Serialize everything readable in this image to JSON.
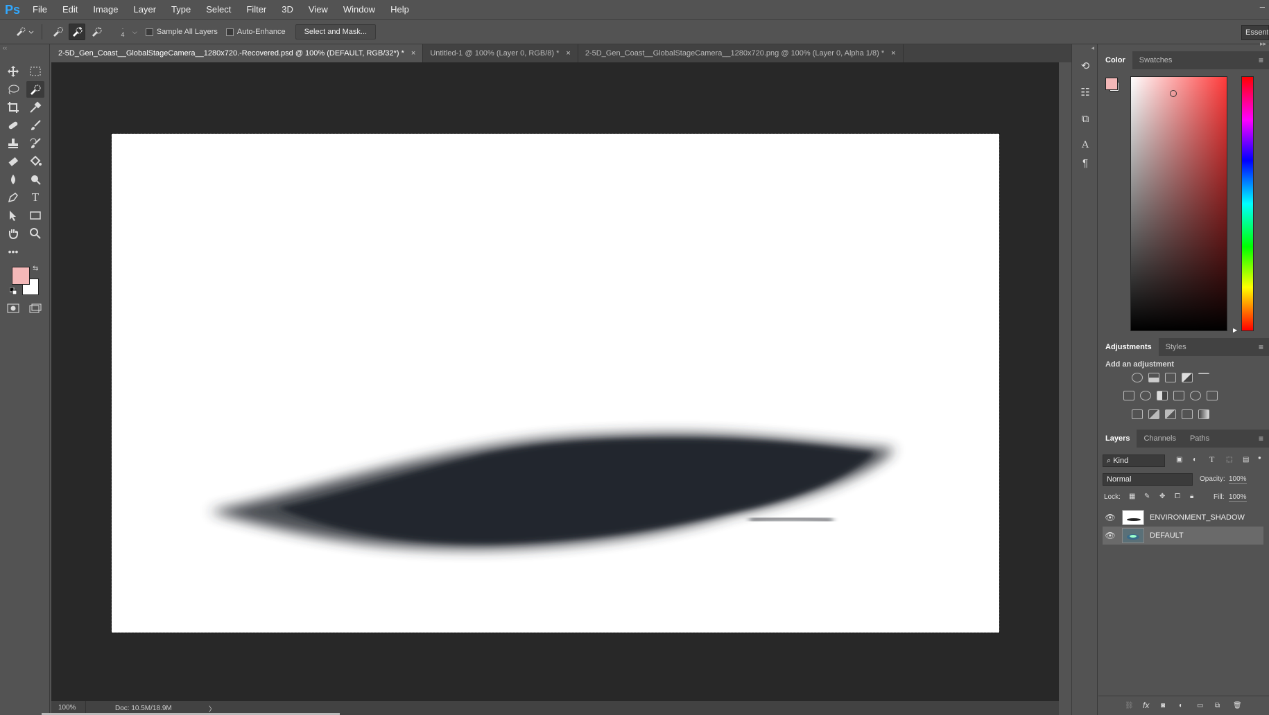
{
  "app": {
    "logo": "Ps",
    "window_controls": "–"
  },
  "menu": [
    "File",
    "Edit",
    "Image",
    "Layer",
    "Type",
    "Select",
    "Filter",
    "3D",
    "View",
    "Window",
    "Help"
  ],
  "options_bar": {
    "brush_size": "4",
    "sample_all_layers": "Sample All Layers",
    "auto_enhance": "Auto-Enhance",
    "select_and_mask": "Select and Mask...",
    "workspace": "Essentials"
  },
  "tabs": [
    {
      "label": "2-5D_Gen_Coast__GlobalStageCamera__1280x720.-Recovered.psd @ 100% (DEFAULT, RGB/32*) *",
      "active": true
    },
    {
      "label": "Untitled-1 @ 100% (Layer 0, RGB/8) *",
      "active": false
    },
    {
      "label": "2-5D_Gen_Coast__GlobalStageCamera__1280x720.png @ 100% (Layer 0, Alpha 1/8) *",
      "active": false
    }
  ],
  "close_glyph": "×",
  "status": {
    "zoom": "100%",
    "doc": "Doc: 10.5M/18.9M",
    "arrow": "〉"
  },
  "colors": {
    "foreground": "#f4b8b8",
    "background": "#ffffff",
    "ui_bg": "#535353",
    "canvas_bg": "#282828",
    "shadow": "#23262f"
  },
  "color_panel": {
    "tabs": [
      "Color",
      "Swatches"
    ]
  },
  "adjustments_panel": {
    "tabs": [
      "Adjustments",
      "Styles"
    ],
    "heading": "Add an adjustment"
  },
  "layers_panel": {
    "tabs": [
      "Layers",
      "Channels",
      "Paths"
    ],
    "kind_label": "Kind",
    "blend_mode": "Normal",
    "opacity_label": "Opacity:",
    "opacity_value": "100%",
    "lock_label": "Lock:",
    "fill_label": "Fill:",
    "fill_value": "100%",
    "layers": [
      {
        "name": "ENVIRONMENT_SHADOW",
        "visible": true,
        "selected": false
      },
      {
        "name": "DEFAULT",
        "visible": true,
        "selected": true
      }
    ],
    "fx_label": "fx"
  }
}
